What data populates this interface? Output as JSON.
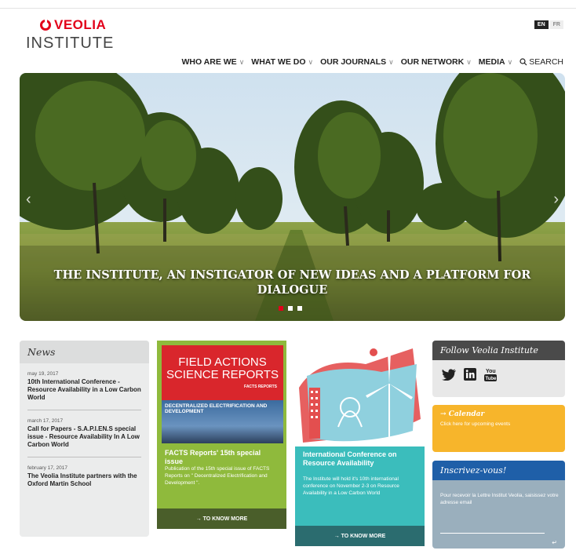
{
  "logo": {
    "brand": "VEOLIA",
    "sub": "INSTITUTE"
  },
  "lang": {
    "active": "EN",
    "other": "FR"
  },
  "nav": {
    "items": [
      {
        "label": "WHO ARE WE"
      },
      {
        "label": "WHAT WE DO"
      },
      {
        "label": "OUR JOURNALS"
      },
      {
        "label": "OUR NETWORK"
      },
      {
        "label": "MEDIA"
      }
    ],
    "search": "SEARCH"
  },
  "hero": {
    "title": "THE INSTITUTE, AN INSTIGATOR OF NEW IDEAS AND A PLATFORM FOR DIALOGUE",
    "slides": 3,
    "active_slide": 1
  },
  "news": {
    "heading": "News",
    "items": [
      {
        "date": "may 19, 2017",
        "title": "10th International Conference - Resource Availability in a Low Carbon World"
      },
      {
        "date": "march 17, 2017",
        "title": "Call for Papers - S.A.P.I.EN.S special issue - Resource Availability In A Low Carbon World"
      },
      {
        "date": "february 17, 2017",
        "title": "The Veolia Institute partners with the Oxford Martin School"
      }
    ]
  },
  "facts": {
    "image_title": "FIELD ACTIONS SCIENCE REPORTS",
    "image_badge": "FACTS REPORTS",
    "image_sub": "DECENTRALIZED ELECTRIFICATION AND DEVELOPMENT",
    "title": "FACTS Reports' 15th special issue",
    "text": "Publication of the 15th special issue of FACTS Reports on \" Decentralized Electrification and Development \".",
    "button": "→  TO KNOW MORE"
  },
  "conference": {
    "title": "International Conference on Resource Availability",
    "text": "The Institute will hold it's 10th international conference on November 2-3 on Resource Availability in a Low Carbon World",
    "button": "→  TO KNOW MORE"
  },
  "follow": {
    "heading": "Follow Veolia Institute"
  },
  "calendar": {
    "title": "→ Calendar",
    "subtitle": "Click here for upcoming events"
  },
  "newsletter": {
    "heading": "Inscrivez-vous!",
    "text": "Pour recevoir la Lettre Institut Veolia, saisissez votre adresse email",
    "send": "↵"
  },
  "colors": {
    "brand_red": "#e2001a",
    "facts_green": "#8fba3c",
    "conf_teal": "#3bbdbc",
    "calendar_yellow": "#f7b52b",
    "newsletter_blue": "#1f5fa8"
  }
}
